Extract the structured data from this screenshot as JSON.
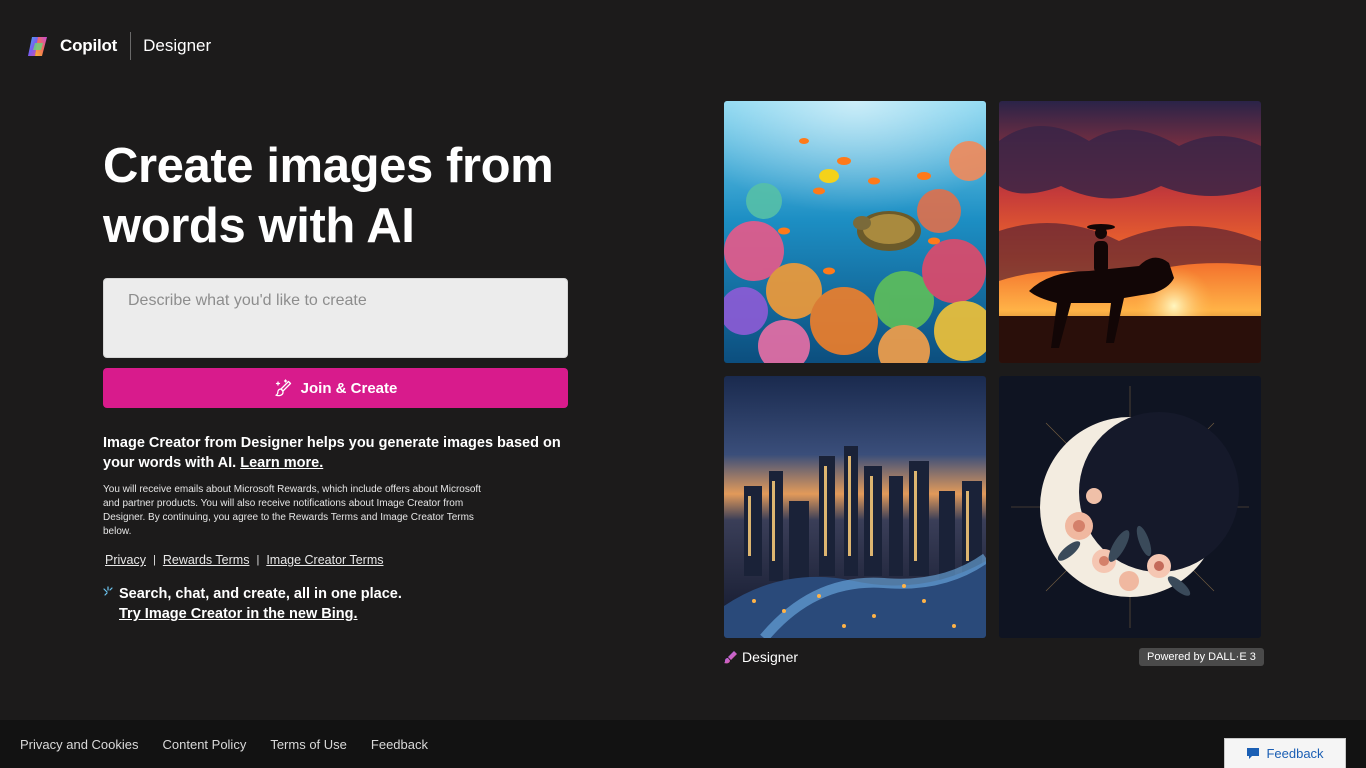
{
  "header": {
    "brand": "Copilot",
    "product": "Designer"
  },
  "hero": {
    "title_line1": "Create images from",
    "title_line2": "words with AI"
  },
  "prompt": {
    "placeholder": "Describe what you'd like to create",
    "value": ""
  },
  "join_button": {
    "label": "Join & Create",
    "color": "#d81b8c"
  },
  "description": {
    "text": "Image Creator from Designer helps you generate images based on your words with AI.",
    "learn_more": "Learn more."
  },
  "fine_print": "You will receive emails about Microsoft Rewards, which include offers about Microsoft and partner products. You will also receive notifications about Image Creator from Designer. By continuing, you agree to the Rewards Terms and Image Creator Terms below.",
  "terms_links": {
    "privacy": "Privacy",
    "separator": "|",
    "rewards": "Rewards Terms",
    "image_creator": "Image Creator Terms"
  },
  "bing_promo": {
    "line1": "Search, chat, and create, all in one place.",
    "link": "Try Image Creator in the new Bing."
  },
  "gallery": {
    "images": [
      {
        "subject": "coral-reef-sea-turtle-image"
      },
      {
        "subject": "cowboy-sunset-silhouette-image"
      },
      {
        "subject": "city-night-river-image"
      },
      {
        "subject": "floral-crescent-moon-image"
      }
    ],
    "designer_label": "Designer",
    "powered_by": "Powered by DALL·E 3"
  },
  "footer": {
    "links": [
      "Privacy and Cookies",
      "Content Policy",
      "Terms of Use",
      "Feedback"
    ],
    "feedback_button": "Feedback"
  }
}
